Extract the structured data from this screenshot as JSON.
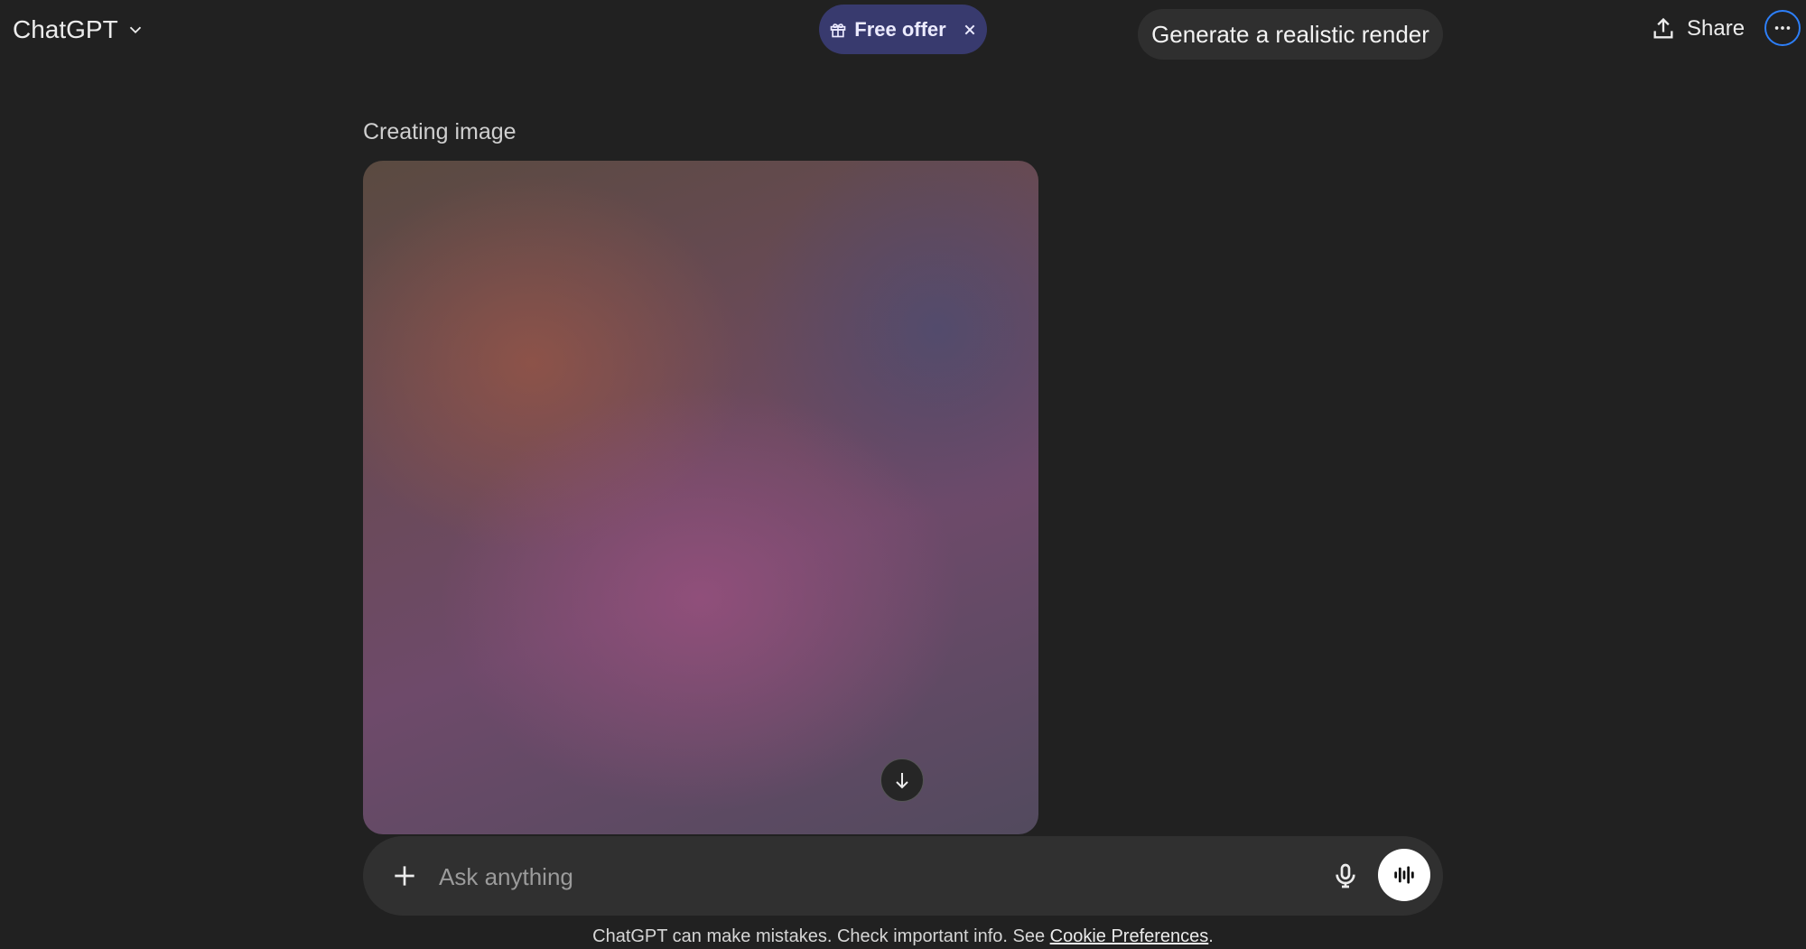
{
  "header": {
    "model_name": "ChatGPT",
    "offer_label": "Free offer",
    "suggestion": "Generate a realistic render",
    "share_label": "Share"
  },
  "main": {
    "status": "Creating image"
  },
  "composer": {
    "placeholder": "Ask anything"
  },
  "footer": {
    "disclaimer_text": "ChatGPT can make mistakes. Check important info. See ",
    "link_label": "Cookie Preferences",
    "suffix": "."
  },
  "icons": {
    "model_dropdown": "chevron-down-icon",
    "offer": "gift-icon",
    "offer_close": "close-icon",
    "share": "upload-icon",
    "more": "more-horizontal-icon",
    "scroll": "arrow-down-icon",
    "attach": "plus-icon",
    "mic": "mic-icon",
    "voice": "voice-waveform-icon"
  },
  "colors": {
    "background": "#212121",
    "offer_pill": "#383a6e",
    "composer": "#303030",
    "accent_ring": "#2d7ff9"
  }
}
